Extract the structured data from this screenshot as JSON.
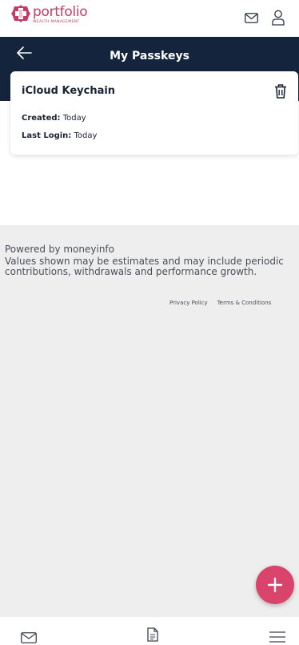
{
  "brand": {
    "name": "portfolio",
    "tagline": "WEALTH MANAGEMENT",
    "color": "#c23c63"
  },
  "top_icons": [
    "mail-icon",
    "user-icon"
  ],
  "header": {
    "title": "My Passkeys",
    "background": "#14243d"
  },
  "passkey": {
    "name": "iCloud Keychain",
    "created_label": "Created:",
    "created_value": "Today",
    "last_login_label": "Last Login:",
    "last_login_value": "Today"
  },
  "footer": {
    "powered_by": "Powered by moneyinfo",
    "disclaimer": "Values shown may be estimates and may include periodic contributions, withdrawals and performance growth.",
    "privacy_link": "Privacy Policy",
    "terms_link": "Terms & Conditions"
  },
  "fab": {
    "icon": "plus-icon",
    "color": "#d9446c"
  },
  "bottom_nav": [
    "mail-icon",
    "document-icon",
    "menu-icon"
  ]
}
